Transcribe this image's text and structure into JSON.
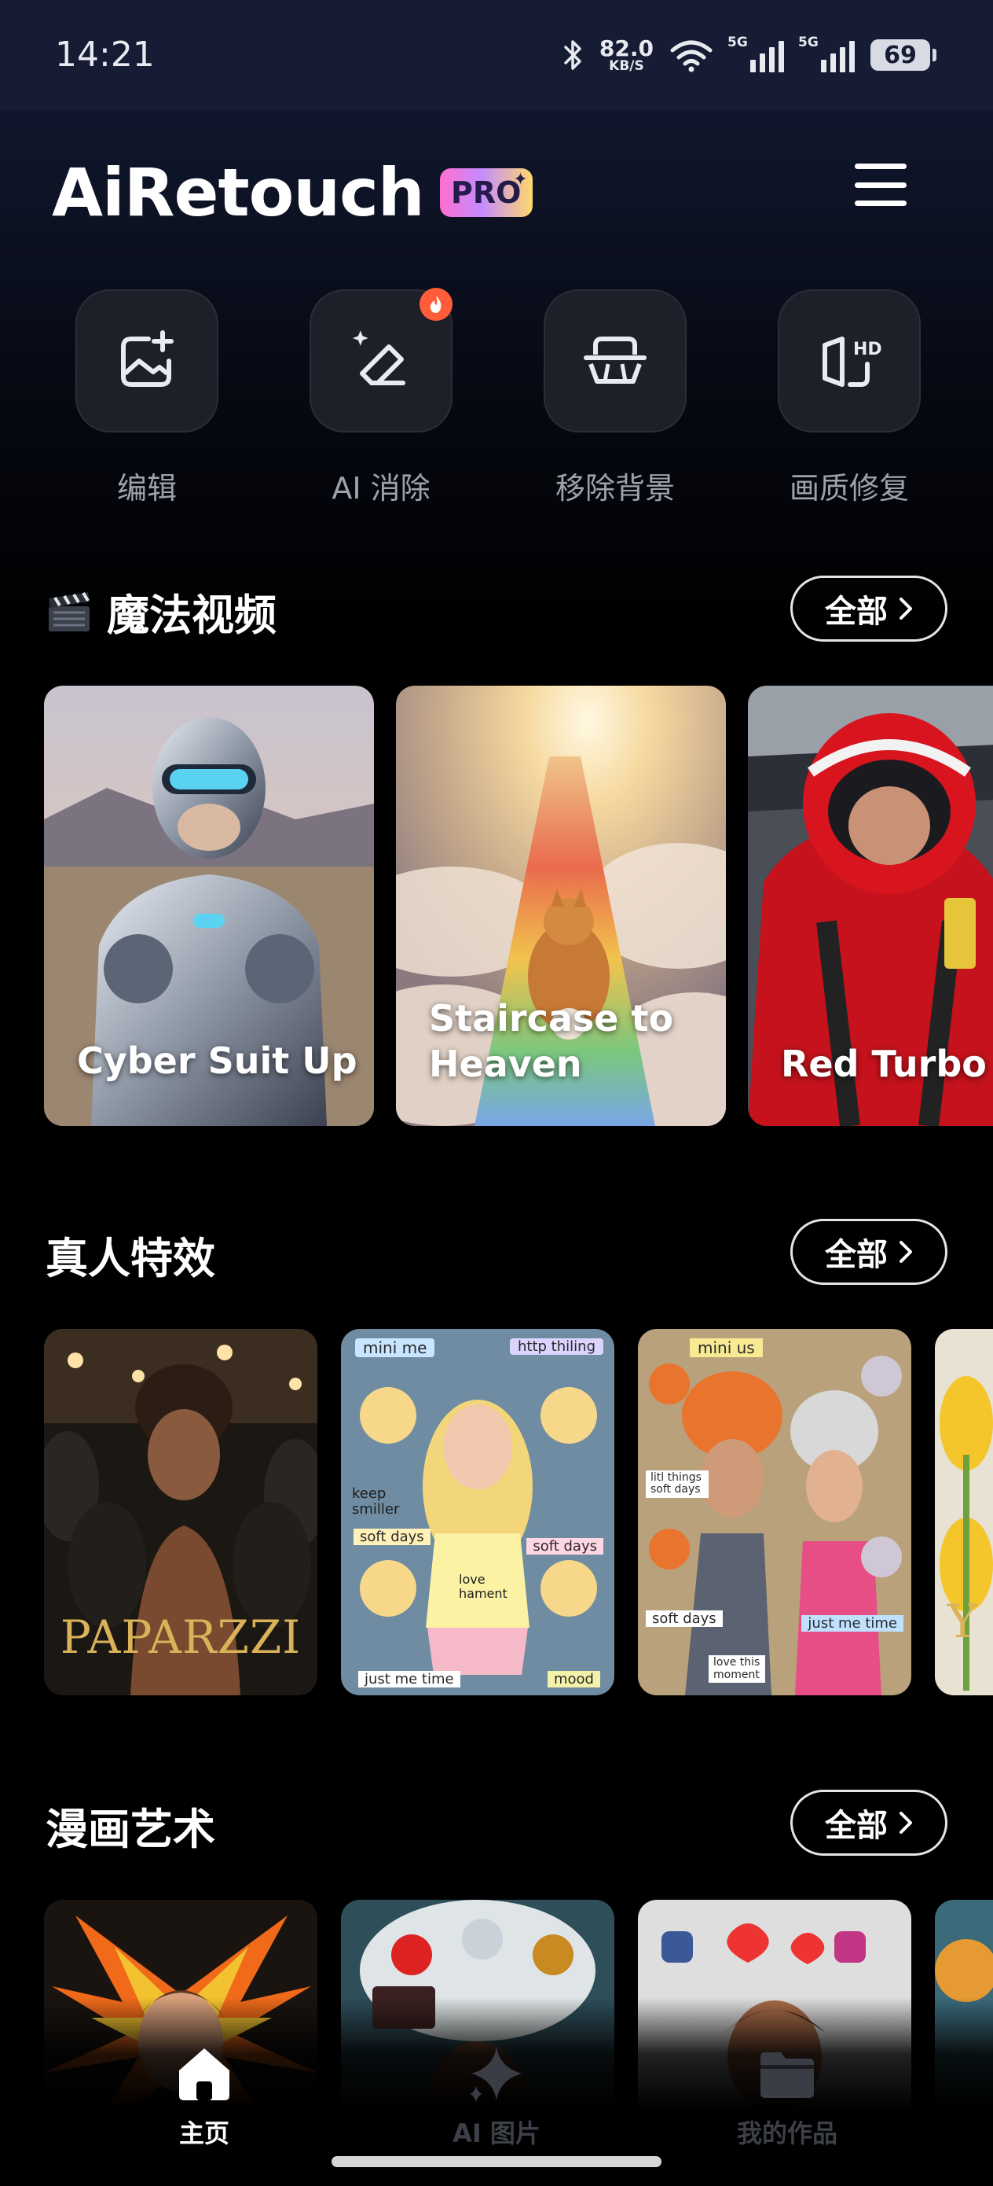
{
  "status_bar": {
    "time": "14:21",
    "net_speed_value": "82.0",
    "net_speed_unit": "KB/S",
    "signal1_label": "5G",
    "signal2_label": "5G",
    "battery": "69",
    "icons": [
      "bluetooth-icon",
      "wifi-icon",
      "signal-icon",
      "signal-icon",
      "battery-icon"
    ]
  },
  "header": {
    "logo_text": "AiRetouch",
    "badge": "PRO",
    "menu_icon": "hamburger-menu-icon"
  },
  "tools": [
    {
      "label": "编辑",
      "icon": "image-add-icon"
    },
    {
      "label": "AI 消除",
      "icon": "eraser-sparkle-icon",
      "badge_icon": "fire-icon"
    },
    {
      "label": "移除背景",
      "icon": "remove-background-icon"
    },
    {
      "label": "画质修复",
      "icon": "hd-repair-icon"
    }
  ],
  "sections": {
    "magic_video": {
      "title": "魔法视频",
      "title_icon": "clapperboard-icon",
      "all_label": "全部",
      "cards": [
        {
          "label": "Cyber Suit Up"
        },
        {
          "label": "Staircase to Heaven"
        },
        {
          "label": "Red Turbo"
        }
      ]
    },
    "real_person": {
      "title": "真人特效",
      "all_label": "全部",
      "cards": [
        {
          "overlay_text": "PAPARZZI"
        },
        {
          "stickers": [
            "mini me",
            "http thiling",
            "keep smiller",
            "soft days",
            "soft days",
            "love hament",
            "just me time",
            "mood"
          ]
        },
        {
          "stickers": [
            "mini us",
            "litl things soft days",
            "soft days",
            "just me time",
            "love this moment"
          ]
        },
        {
          "overlay_text": "Y"
        }
      ]
    },
    "comic_art": {
      "title": "漫画艺术",
      "all_label": "全部"
    }
  },
  "bottom_nav": [
    {
      "label": "主页",
      "icon": "home-icon",
      "active": true
    },
    {
      "label": "AI 图片",
      "icon": "sparkle-icon",
      "active": false
    },
    {
      "label": "我的作品",
      "icon": "folder-icon",
      "active": false
    }
  ],
  "colors": {
    "background": "#000000",
    "header_bg": "#151c33",
    "tool_tile": "#1d2029",
    "accent_fire": "#ff5d3a",
    "muted_label": "#9ea2ad"
  }
}
